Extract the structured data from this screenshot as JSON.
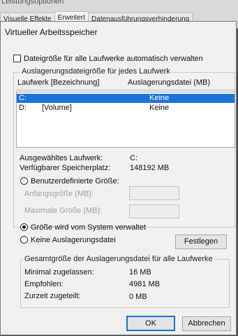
{
  "background_window": {
    "title": "Leistungsoptionen",
    "tabs": [
      "Visuelle Effekte",
      "Erweitert",
      "Datenausführungsverhinderung"
    ]
  },
  "dialog": {
    "title": "Virtueller Arbeitsspeicher",
    "auto_manage_label": "Dateigröße für alle Laufwerke automatisch verwalten",
    "auto_manage_checked": false,
    "group_per_drive_label": "Auslagerungsdateigröße für jedes Laufwerk",
    "list": {
      "col_drive": "Laufwerk [Bezeichnung]",
      "col_pagefile": "Auslagerungsdatei (MB)",
      "rows": [
        {
          "drive": "C:",
          "label": "",
          "pagefile": "Keine",
          "selected": true
        },
        {
          "drive": "D:",
          "label": "[Volume]",
          "pagefile": "Keine",
          "selected": false
        }
      ]
    },
    "selected_drive_label": "Ausgewähltes Laufwerk:",
    "selected_drive_value": "C:",
    "available_space_label": "Verfügbarer Speicherplatz:",
    "available_space_value": "148192 MB",
    "custom_size_label": "Benutzerdefinierte Größe:",
    "initial_size_label": "Anfangsgröße (MB):",
    "initial_size_value": "",
    "max_size_label": "Maximale Größe (MB):",
    "max_size_value": "",
    "system_managed_label": "Größe wird vom System verwaltet",
    "no_pagefile_label": "Keine Auslagerungsdatei",
    "selected_option": "system_managed",
    "set_button": "Festlegen",
    "group_total_label": "Gesamtgröße der Auslagerungsdatei für alle Laufwerke",
    "min_allowed_label": "Minimal zugelassen:",
    "min_allowed_value": "16 MB",
    "recommended_label": "Empfohlen:",
    "recommended_value": "4981 MB",
    "currently_allocated_label": "Zurzeit zugeteilt:",
    "currently_allocated_value": "0 MB",
    "ok_button": "OK",
    "cancel_button": "Abbrechen"
  }
}
